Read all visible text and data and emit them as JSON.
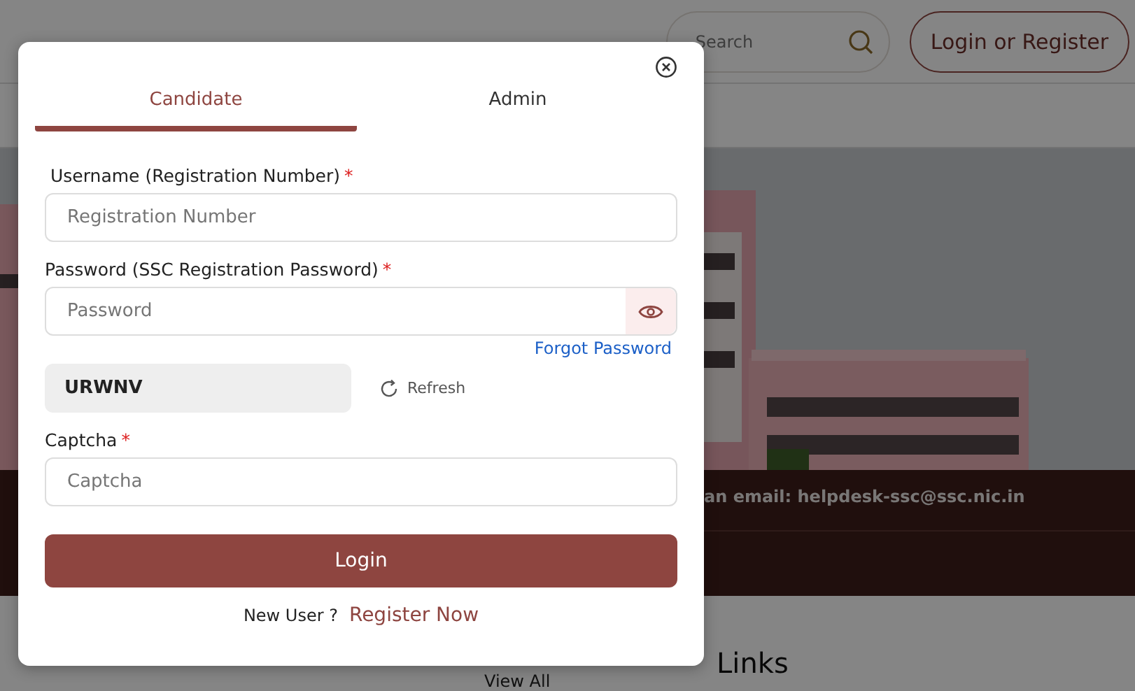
{
  "header": {
    "search": {
      "placeholder": "Search"
    },
    "login_button": "Login or Register"
  },
  "banner": {
    "kind": "picture",
    "notice": "an email: helpdesk-ssc@ssc.nic.in"
  },
  "section": {
    "heading": "Links",
    "link": "View All"
  },
  "modal": {
    "tabs": [
      {
        "label": "Candidate",
        "selected": true
      },
      {
        "label": "Admin",
        "selected": false
      }
    ],
    "fields": [
      {
        "kind": "text",
        "label": "Username (Registration Number)",
        "required_mark": "*",
        "placeholder": "Registration Number"
      },
      {
        "kind": "password",
        "label": "Password (SSC Registration Password)",
        "required_mark": "*",
        "placeholder": "Password"
      }
    ],
    "forgot_link": "Forgot Password",
    "captcha": {
      "code": "URWNV",
      "refresh": "Refresh"
    },
    "captcha_field": {
      "label": "Captcha",
      "required_mark": "*",
      "placeholder": "Captcha"
    },
    "login_button": "Login",
    "footer": {
      "prompt": "New User ?",
      "link": "Register Now"
    }
  }
}
